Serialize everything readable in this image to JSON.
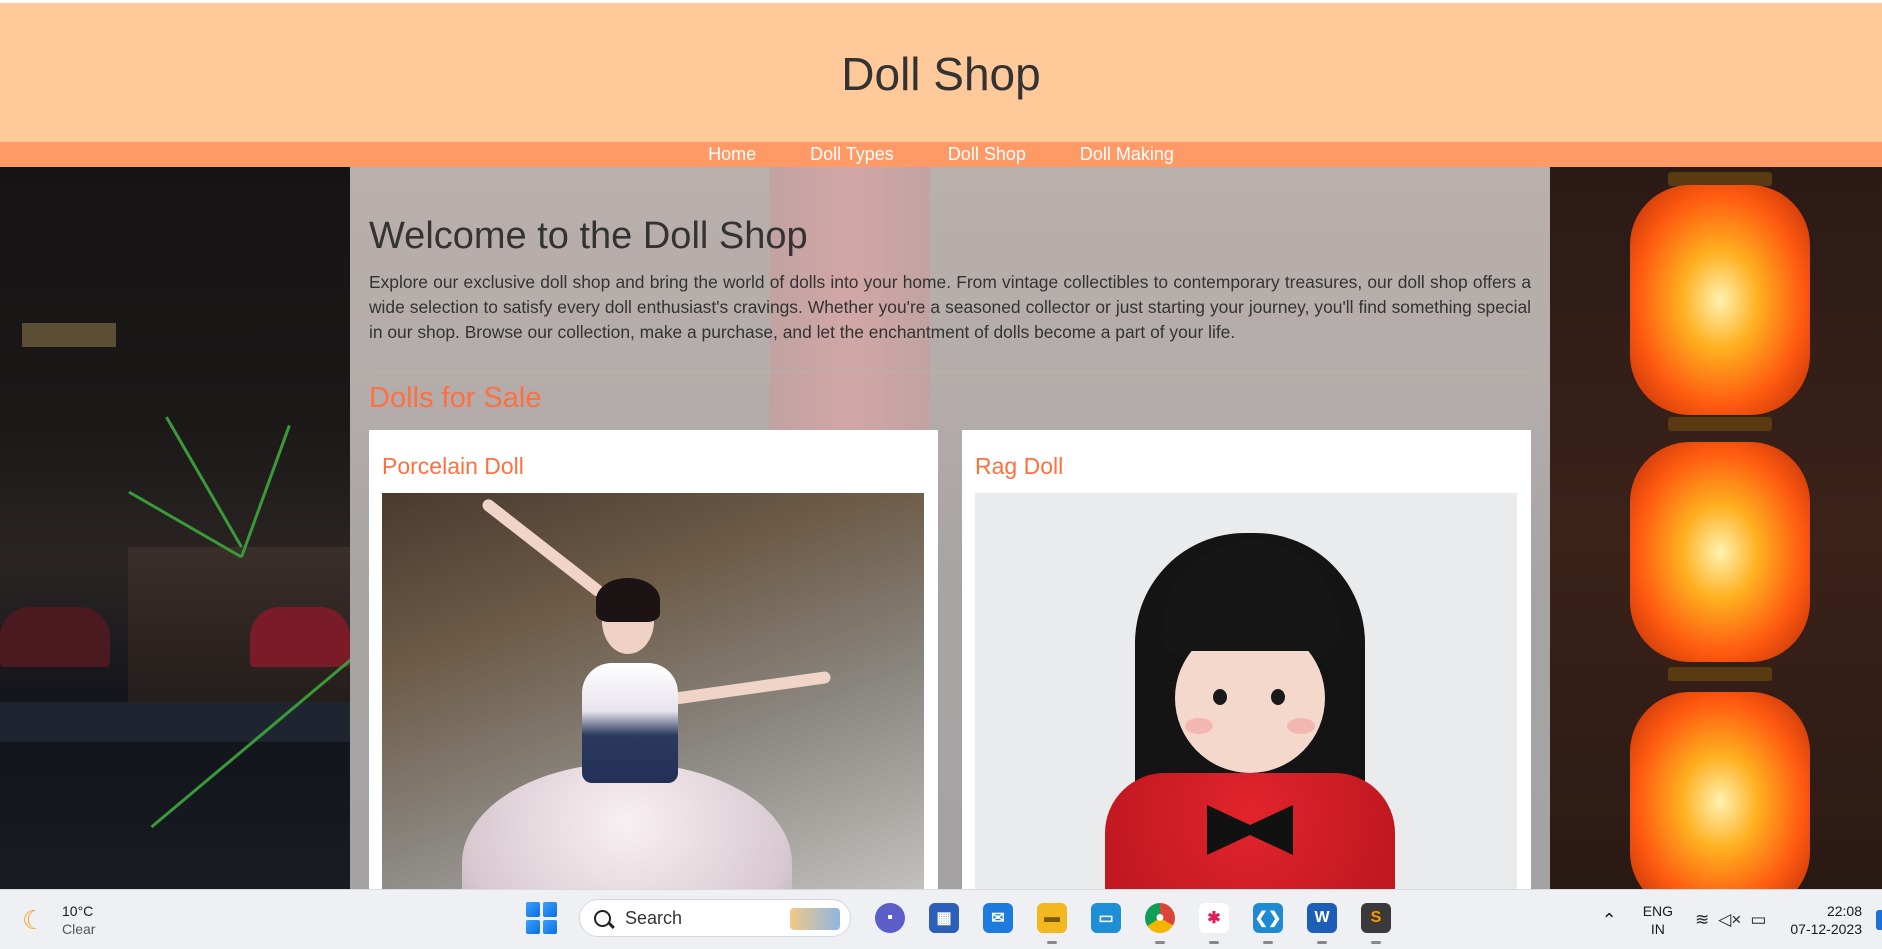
{
  "site": {
    "title": "Doll Shop",
    "nav": [
      "Home",
      "Doll Types",
      "Doll Shop",
      "Doll Making"
    ]
  },
  "main": {
    "heading": "Welcome to the Doll Shop",
    "intro": "Explore our exclusive doll shop and bring the world of dolls into your home. From vintage collectibles to contemporary treasures, our doll shop offers a wide selection to satisfy every doll enthusiast's cravings. Whether you're a seasoned collector or just starting your journey, you'll find something special in our shop. Browse our collection, make a purchase, and let the enchantment of dolls become a part of your life.",
    "section_heading": "Dolls for Sale",
    "products": [
      {
        "name": "Porcelain Doll",
        "image": "porcelain-doll-photo"
      },
      {
        "name": "Rag Doll",
        "image": "rag-doll-photo"
      }
    ]
  },
  "taskbar": {
    "weather": {
      "temp": "10°C",
      "condition": "Clear",
      "icon": "moon-icon"
    },
    "search_label": "Search",
    "apps": [
      "start-icon",
      "teams-chat-icon",
      "store-icon",
      "mail-icon",
      "file-explorer-icon",
      "remote-desktop-icon",
      "chrome-icon",
      "slack-icon",
      "vscode-icon",
      "word-icon",
      "sublime-text-icon"
    ],
    "language": {
      "line1": "ENG",
      "line2": "IN"
    },
    "clock": {
      "time": "22:08",
      "date": "07-12-2023"
    }
  },
  "colors": {
    "header_bg": "#ffc999",
    "nav_bg": "#ff9a66",
    "accent": "#ff6f40",
    "text": "#333333"
  }
}
